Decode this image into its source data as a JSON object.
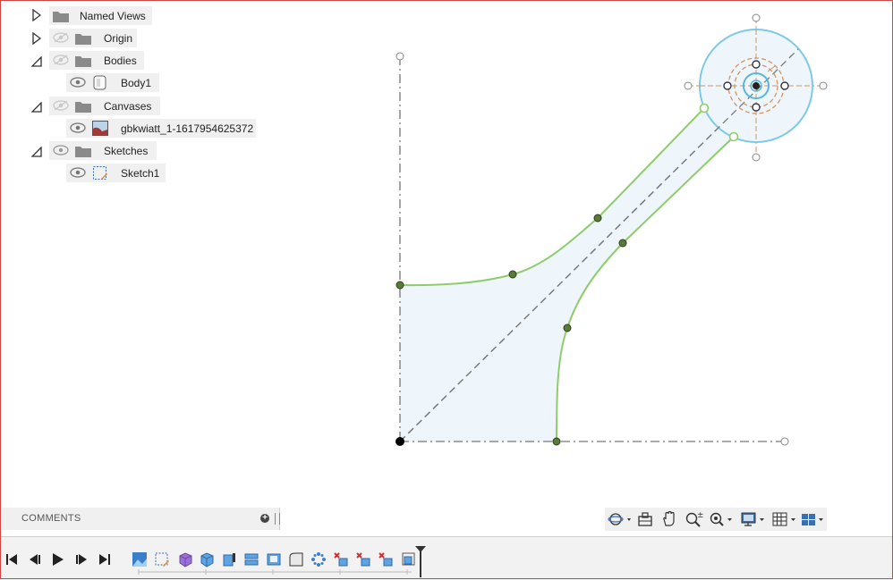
{
  "browser": {
    "items": [
      {
        "label": "Named Views",
        "expander": "collapsed",
        "visible_toggle": false,
        "icon": "folder-icon"
      },
      {
        "label": "Origin",
        "expander": "collapsed",
        "visible_toggle": true,
        "icon": "folder-icon"
      },
      {
        "label": "Bodies",
        "expander": "expanded",
        "visible_toggle": true,
        "icon": "folder-icon"
      },
      {
        "label": "Body1",
        "expander": "none",
        "visible_toggle": true,
        "icon": "body-icon"
      },
      {
        "label": "Canvases",
        "expander": "expanded",
        "visible_toggle": true,
        "icon": "folder-icon"
      },
      {
        "label": "gbkwiatt_1-1617954625372",
        "expander": "none",
        "visible_toggle": true,
        "icon": "canvas-image-icon"
      },
      {
        "label": "Sketches",
        "expander": "expanded",
        "visible_toggle": true,
        "icon": "folder-icon"
      },
      {
        "label": "Sketch1",
        "expander": "none",
        "visible_toggle": true,
        "icon": "sketch-icon"
      }
    ]
  },
  "comments": {
    "label": "COMMENTS"
  },
  "navbar": {
    "tools": [
      "orbit-icon",
      "look-at-icon",
      "pan-icon",
      "zoom-icon",
      "fit-icon",
      "display-settings-icon",
      "grid-settings-icon",
      "viewports-icon"
    ]
  },
  "timeline": {
    "controls": [
      "go-to-start-icon",
      "step-back-icon",
      "play-icon",
      "step-forward-icon",
      "go-to-end-icon"
    ],
    "features": [
      "canvas-feature-icon",
      "sketch-feature-icon",
      "form-feature-icon",
      "extrude-feature-icon",
      "extrude-feature-icon",
      "split-feature-icon",
      "shell-feature-icon",
      "fillet-feature-icon",
      "pattern-feature-icon",
      "combine-feature-icon",
      "combine-feature-icon",
      "combine-feature-icon",
      "sketch-feature-icon"
    ]
  },
  "colors": {
    "sketch_profile_fill": "#eef6fc",
    "sketch_line": "#8fcc6b",
    "construction_line": "#777777",
    "circle": "#7ec9e6",
    "dimension_orange": "#d09562",
    "frame_border": "#d24545"
  }
}
